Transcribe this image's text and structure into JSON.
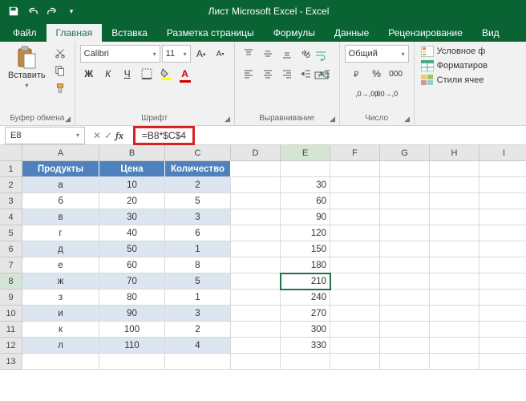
{
  "title": "Лист Microsoft Excel - Excel",
  "tabs": [
    "Файл",
    "Главная",
    "Вставка",
    "Разметка страницы",
    "Формулы",
    "Данные",
    "Рецензирование",
    "Вид"
  ],
  "active_tab": 1,
  "ribbon": {
    "clipboard": {
      "label": "Буфер обмена",
      "paste": "Вставить"
    },
    "font": {
      "label": "Шрифт",
      "family": "Calibri",
      "size": "11",
      "bold": "Ж",
      "italic": "К",
      "underline": "Ч"
    },
    "alignment": {
      "label": "Выравнивание",
      "wrap_icon": "↩"
    },
    "number": {
      "label": "Число",
      "format": "Общий"
    },
    "styles": {
      "conditional": "Условное ф",
      "table": "Форматиров",
      "cell": "Стили ячее"
    }
  },
  "namebox": "E8",
  "formula": "=B8*$C$4",
  "columns": [
    "A",
    "B",
    "C",
    "D",
    "E",
    "F",
    "G",
    "H",
    "I"
  ],
  "sheet": {
    "headers": [
      "Продукты",
      "Цена",
      "Количество"
    ],
    "rows": [
      {
        "p": "а",
        "price": "10",
        "qty": "2",
        "e": "30"
      },
      {
        "p": "б",
        "price": "20",
        "qty": "5",
        "e": "60"
      },
      {
        "p": "в",
        "price": "30",
        "qty": "3",
        "e": "90"
      },
      {
        "p": "г",
        "price": "40",
        "qty": "6",
        "e": "120"
      },
      {
        "p": "д",
        "price": "50",
        "qty": "1",
        "e": "150"
      },
      {
        "p": "е",
        "price": "60",
        "qty": "8",
        "e": "180"
      },
      {
        "p": "ж",
        "price": "70",
        "qty": "5",
        "e": "210"
      },
      {
        "p": "з",
        "price": "80",
        "qty": "1",
        "e": "240"
      },
      {
        "p": "и",
        "price": "90",
        "qty": "3",
        "e": "270"
      },
      {
        "p": "к",
        "price": "100",
        "qty": "2",
        "e": "300"
      },
      {
        "p": "л",
        "price": "110",
        "qty": "4",
        "e": "330"
      }
    ]
  },
  "active_cell": {
    "row": 8,
    "col": "E"
  }
}
